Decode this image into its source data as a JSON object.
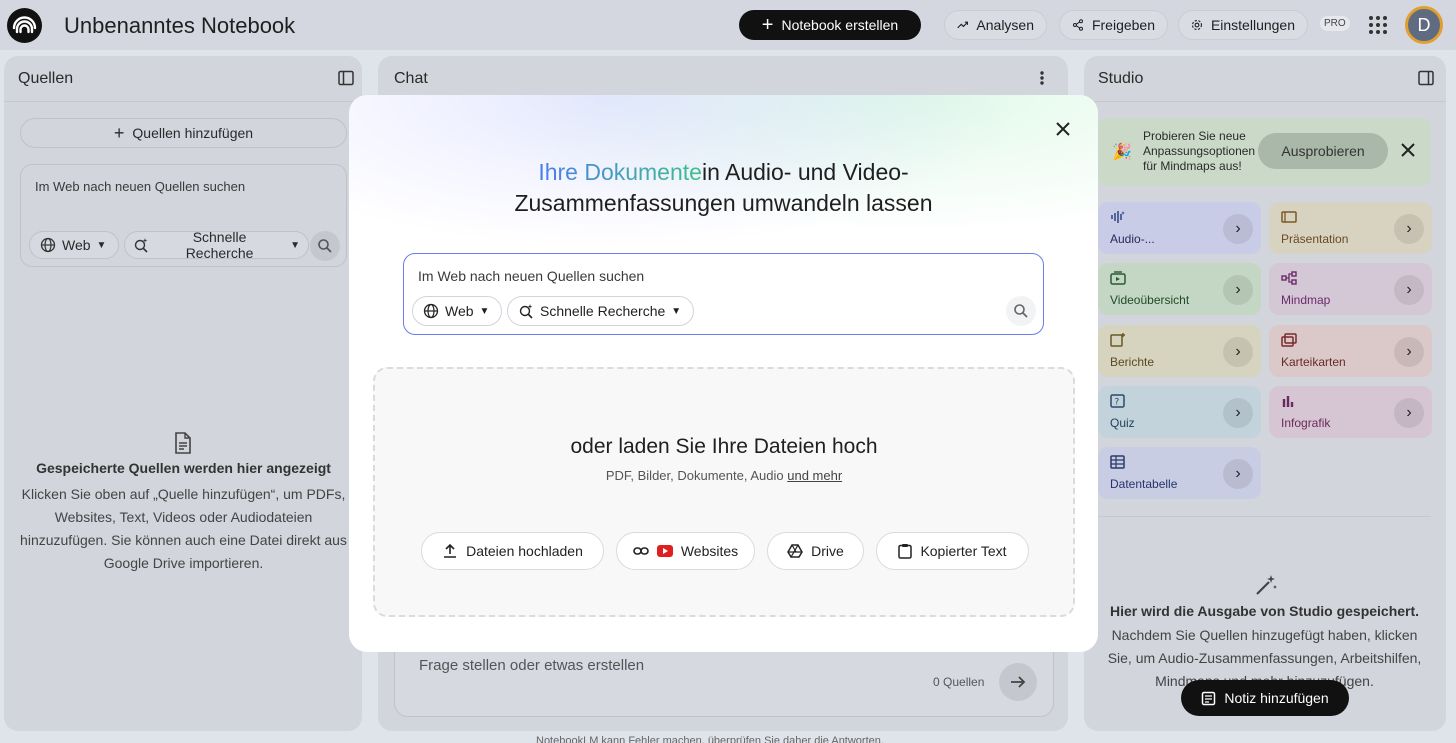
{
  "header": {
    "title": "Unbenanntes Notebook",
    "create_label": "Notebook erstellen",
    "analytics_label": "Analysen",
    "share_label": "Freigeben",
    "settings_label": "Einstellungen",
    "pro_badge": "PRO",
    "avatar_initial": "D"
  },
  "sources": {
    "title": "Quellen",
    "add_label": "Quellen hinzufügen",
    "search_placeholder": "Im Web nach neuen Quellen suchen",
    "web_chip": "Web",
    "research_chip_line1": "Schnelle",
    "research_chip_line2": "Recherche",
    "empty_title": "Gespeicherte Quellen werden hier angezeigt",
    "empty_desc": "Klicken Sie oben auf „Quelle hinzufügen“, um PDFs, Websites, Text, Videos oder Audiodateien hinzuzufügen. Sie können auch eine Datei direkt aus Google Drive importieren."
  },
  "chat": {
    "title": "Chat",
    "input_placeholder": "Frage stellen oder etwas erstellen",
    "source_count": "0 Quellen",
    "footer": "NotebookLM kann Fehler machen, überprüfen Sie daher die Antworten."
  },
  "studio": {
    "title": "Studio",
    "promo_text": "Probieren Sie neue Anpassungsoptionen für Mindmaps aus!",
    "promo_button": "Ausprobieren",
    "cards": [
      {
        "label": "Audio-...",
        "color": "#c9cce6"
      },
      {
        "label": "Präsentation",
        "color": "#d8d2c0"
      },
      {
        "label": "Videoübersicht",
        "color": "#c4d6c4"
      },
      {
        "label": "Mindmap",
        "color": "#d5c8d6"
      },
      {
        "label": "Berichte",
        "color": "#d6d3bf"
      },
      {
        "label": "Karteikarten",
        "color": "#dac9c8"
      },
      {
        "label": "Quiz",
        "color": "#c3d3dc"
      },
      {
        "label": "Infografik",
        "color": "#d6c6d4"
      },
      {
        "label": "Datentabelle",
        "color": "#c9cde3"
      }
    ],
    "empty_title": "Hier wird die Ausgabe von Studio gespeichert.",
    "empty_desc": "Nachdem Sie Quellen hinzugefügt haben, klicken Sie, um Audio-Zusammenfassungen, Arbeitshilfen, Mindmaps und mehr hinzuzufügen.",
    "note_button": "Notiz hinzufügen"
  },
  "modal": {
    "headline_highlight": "Ihre Dokumente",
    "headline_rest_line1": "in Audio- und Video-",
    "headline_line2": "Zusammenfassungen umwandeln lassen",
    "search_placeholder": "Im Web nach neuen Quellen suchen",
    "web_chip": "Web",
    "research_chip": "Schnelle Recherche",
    "upload_title": "oder laden Sie Ihre Dateien hoch",
    "upload_subtitle": "PDF, Bilder, Dokumente, Audio",
    "upload_more_link": "und mehr",
    "buttons": {
      "upload": "Dateien hochladen",
      "websites": "Websites",
      "drive": "Drive",
      "copied_text": "Kopierter Text"
    }
  }
}
